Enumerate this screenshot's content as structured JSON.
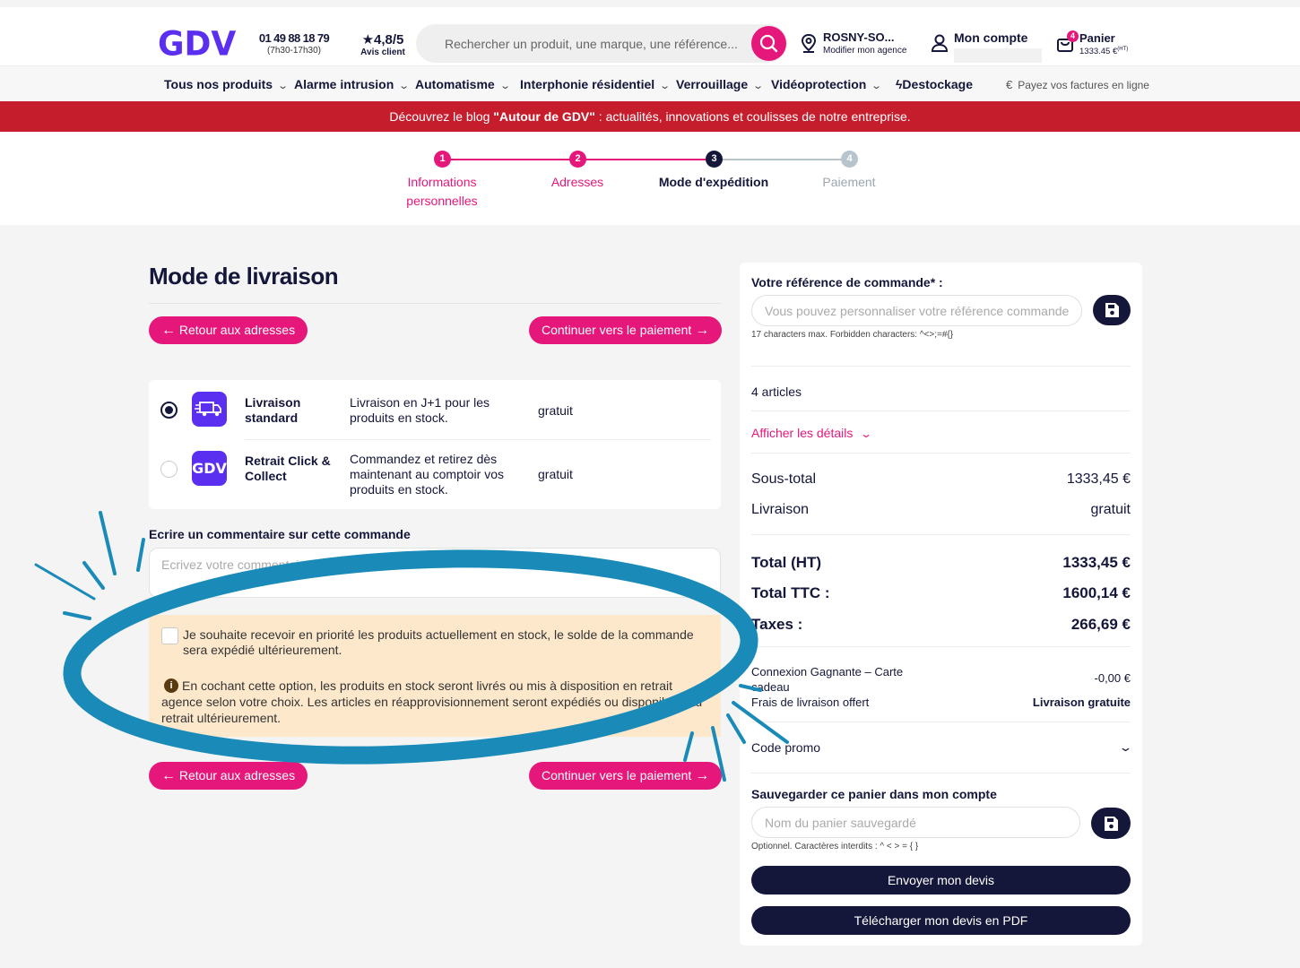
{
  "header": {
    "logo": "GDV",
    "phone": "01 49 88 18 79",
    "hours": "(7h30-17h30)",
    "rating": "4,8/5",
    "rating_label": "Avis client",
    "search_placeholder": "Rechercher un produit, une marque, une référence...",
    "agency_name": "ROSNY-SO...",
    "agency_sub": "Modifier mon agence",
    "account_label": "Mon compte",
    "cart_label": "Panier",
    "cart_amount": "1333.45 €",
    "cart_amount_suffix": "(HT)",
    "cart_count": "4"
  },
  "nav": {
    "items": [
      "Tous nos produits",
      "Alarme intrusion",
      "Automatisme",
      "Interphonie résidentiel",
      "Verrouillage",
      "Vidéoprotection"
    ],
    "destockage": "Destockage",
    "pay_invoices": "Payez vos factures en ligne"
  },
  "banner": {
    "prefix": "Découvrez le blog ",
    "bold": "\"Autour de GDV\"",
    "suffix": " : actualités, innovations et coulisses de notre entreprise."
  },
  "steps": [
    {
      "num": "1",
      "label_line1": "Informations",
      "label_line2": "personnelles"
    },
    {
      "num": "2",
      "label_line1": "Adresses",
      "label_line2": ""
    },
    {
      "num": "3",
      "label_line1": "Mode d'expédition",
      "label_line2": ""
    },
    {
      "num": "4",
      "label_line1": "Paiement",
      "label_line2": ""
    }
  ],
  "main": {
    "title": "Mode de livraison",
    "back_label": "Retour aux adresses",
    "continue_label": "Continuer vers le paiement",
    "shipping": [
      {
        "name_line1": "Livraison",
        "name_line2": "standard",
        "desc": "Livraison en J+1 pour les produits en stock.",
        "price": "gratuit",
        "selected": true
      },
      {
        "name_line1": "Retrait Click &",
        "name_line2": "Collect",
        "desc": "Commandez et retirez dès maintenant au comptoir vos produits en stock.",
        "price": "gratuit",
        "selected": false,
        "icon_text": "GDV"
      }
    ],
    "comment_label": "Ecrire un commentaire sur cette commande",
    "comment_placeholder": "Ecrivez votre commentaire...",
    "stock_option": "Je souhaite recevoir en priorité les produits actuellement en stock, le solde de la commande sera expédié ultérieurement.",
    "stock_info": "En cochant cette option, les produits en stock seront livrés ou mis à disposition en retrait agence selon votre choix. Les articles en réapprovisionnement seront expédiés ou disponibles au retrait ultérieurement."
  },
  "sidebar": {
    "ref_label": "Votre référence de commande* :",
    "ref_placeholder": "Vous pouvez personnaliser votre référence commande",
    "ref_hint": "17 characters max. Forbidden characters: ^<>;=#{}",
    "articles": "4 articles",
    "details_link": "Afficher les détails",
    "subtotal_label": "Sous-total",
    "subtotal_value": "1333,45 €",
    "delivery_label": "Livraison",
    "delivery_value": "gratuit",
    "total_ht_label": "Total (HT)",
    "total_ht_value": "1333,45 €",
    "total_ttc_label": "Total TTC :",
    "total_ttc_value": "1600,14 €",
    "taxes_label": "Taxes :",
    "taxes_value": "266,69 €",
    "promo1_label": "Connexion Gagnante – Carte cadeau",
    "promo1_value": "-0,00 €",
    "promo2_label": "Frais de livraison offert",
    "promo2_value": "Livraison gratuite",
    "promo_code": "Code promo",
    "save_cart_label": "Sauvegarder ce panier dans mon compte",
    "save_cart_placeholder": "Nom du panier sauvegardé",
    "save_cart_hint": "Optionnel. Caractères interdits : ^ < > = { }",
    "send_quote": "Envoyer mon devis",
    "download_quote": "Télécharger mon devis en PDF"
  },
  "colors": {
    "brand_purple": "#5b2ff0",
    "pink": "#e6177a",
    "navy": "#14163a",
    "banner_red": "#c61d2d",
    "annotation_blue": "#1a8bb8"
  }
}
